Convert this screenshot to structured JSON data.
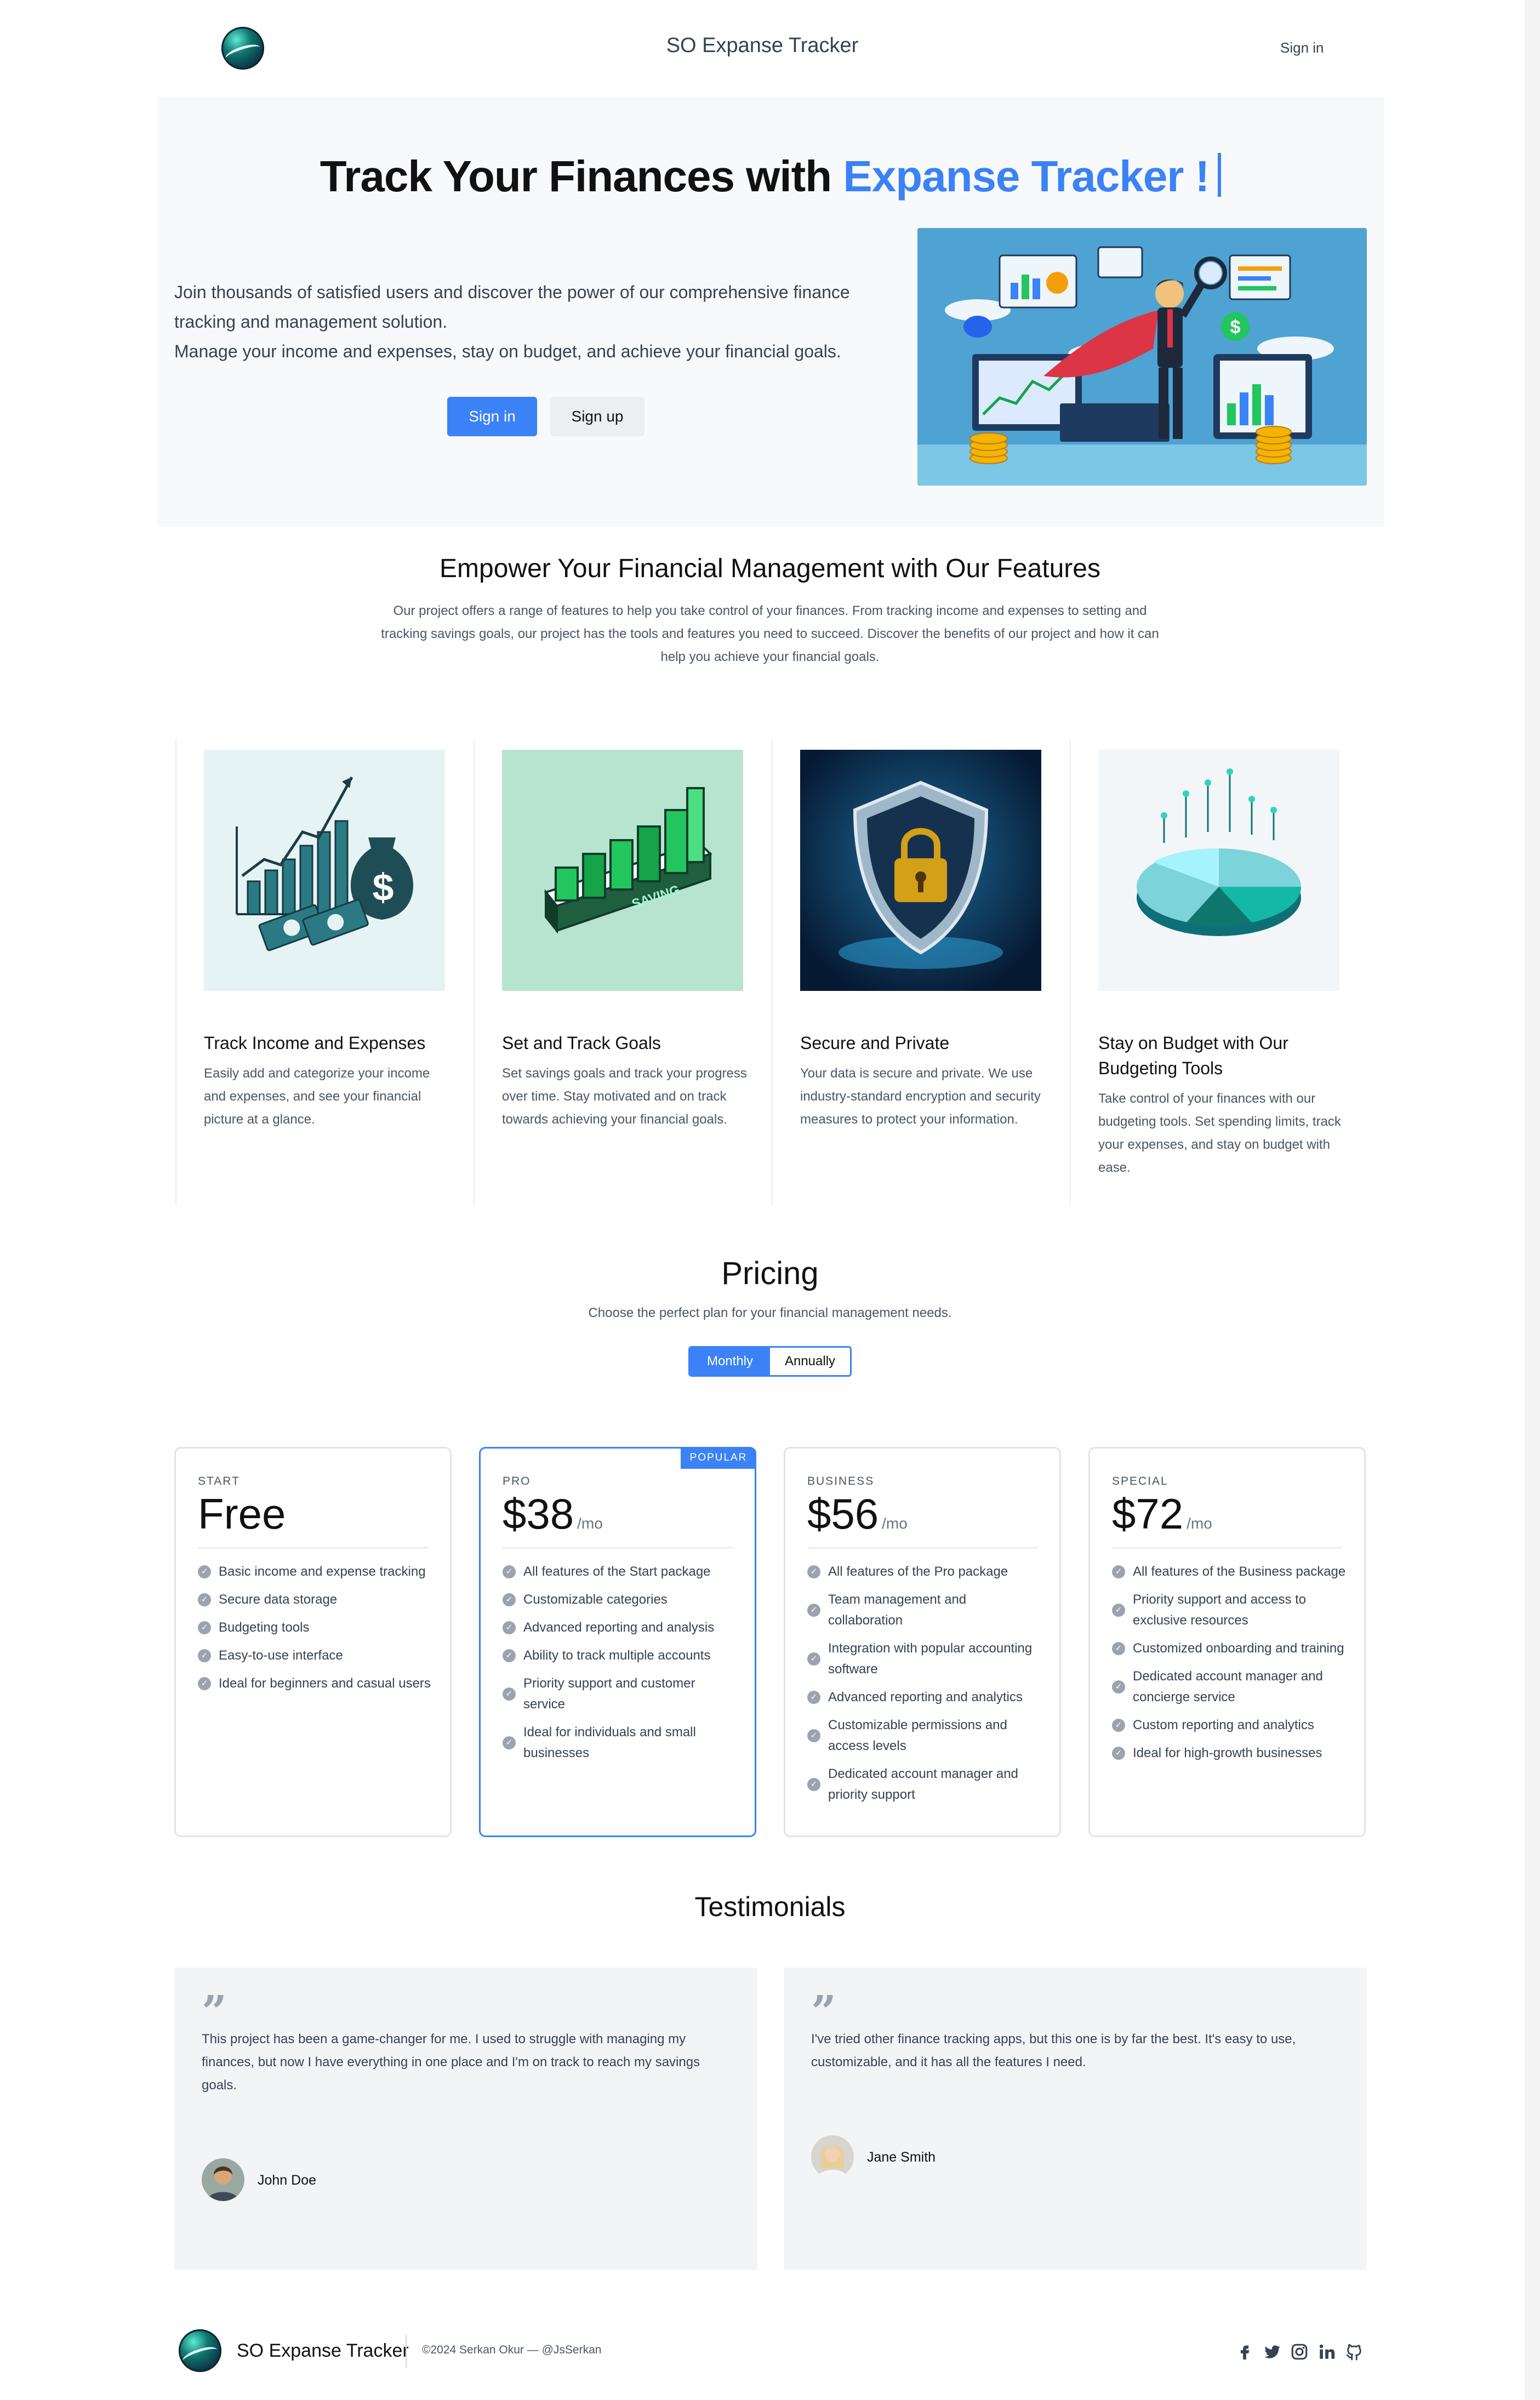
{
  "header": {
    "title": "SO Expanse Tracker",
    "signin": "Sign in"
  },
  "hero": {
    "heading_prefix": "Track Your Finances with ",
    "heading_accent": "Expanse Tracker !",
    "text_line1": "Join thousands of satisfied users and discover the power of our comprehensive finance tracking and management solution.",
    "text_line2": "Manage your income and expenses, stay on budget, and achieve your financial goals.",
    "signin_button": "Sign in",
    "signup_button": "Sign up",
    "accent_color": "#3b82f6"
  },
  "features": {
    "title": "Empower Your Financial Management with Our Features",
    "description": "Our project offers a range of features to help you take control of your finances. From tracking income and expenses to setting and tracking savings goals, our project has the tools and features you need to succeed. Discover the benefits of our project and how it can help you achieve your financial goals.",
    "items": [
      {
        "title": "Track Income and Expenses",
        "desc": "Easily add and categorize your income and expenses, and see your financial picture at a glance."
      },
      {
        "title": "Set and Track Goals",
        "desc": "Set savings goals and track your progress over time. Stay motivated and on track towards achieving your financial goals.",
        "image_label": "SAVING"
      },
      {
        "title": "Secure and Private",
        "desc": "Your data is secure and private. We use industry-standard encryption and security measures to protect your information."
      },
      {
        "title": "Stay on Budget with Our Budgeting Tools",
        "desc": "Take control of your finances with our budgeting tools. Set spending limits, track your expenses, and stay on budget with ease."
      }
    ]
  },
  "pricing": {
    "title": "Pricing",
    "subtitle": "Choose the perfect plan for your financial management needs.",
    "toggle": {
      "monthly": "Monthly",
      "annually": "Annually",
      "selected": "Monthly"
    },
    "plans": [
      {
        "tier": "START",
        "price": "Free",
        "per": "",
        "badge": "",
        "features": [
          "Basic income and expense tracking",
          "Secure data storage",
          "Budgeting tools",
          "Easy-to-use interface",
          "Ideal for beginners and casual users"
        ]
      },
      {
        "tier": "PRO",
        "price": "$38",
        "per": "/mo",
        "badge": "POPULAR",
        "features": [
          "All features of the Start package",
          "Customizable categories",
          "Advanced reporting and analysis",
          "Ability to track multiple accounts",
          "Priority support and customer service",
          "Ideal for individuals and small businesses"
        ]
      },
      {
        "tier": "BUSINESS",
        "price": "$56",
        "per": "/mo",
        "badge": "",
        "features": [
          "All features of the Pro package",
          "Team management and collaboration",
          "Integration with popular accounting software",
          "Advanced reporting and analytics",
          "Customizable permissions and access levels",
          "Dedicated account manager and priority support"
        ]
      },
      {
        "tier": "SPECIAL",
        "price": "$72",
        "per": "/mo",
        "badge": "",
        "features": [
          "All features of the Business package",
          "Priority support and access to exclusive resources",
          "Customized onboarding and training",
          "Dedicated account manager and concierge service",
          "Custom reporting and analytics",
          "Ideal for high-growth businesses"
        ]
      }
    ]
  },
  "testimonials": {
    "title": "Testimonials",
    "items": [
      {
        "quote_mark": "”",
        "text": "This project has been a game-changer for me. I used to struggle with managing my finances, but now I have everything in one place and I'm on track to reach my savings goals.",
        "name": "John Doe"
      },
      {
        "quote_mark": "”",
        "text": "I've tried other finance tracking apps, but this one is by far the best. It's easy to use, customizable, and it has all the features I need.",
        "name": "Jane Smith"
      }
    ]
  },
  "footer": {
    "brand": "SO Expanse Tracker",
    "copyright": "©2024 Serkan Okur — @JsSerkan",
    "social_icons": [
      "facebook-icon",
      "twitter-icon",
      "instagram-icon",
      "linkedin-icon",
      "github-icon"
    ]
  }
}
